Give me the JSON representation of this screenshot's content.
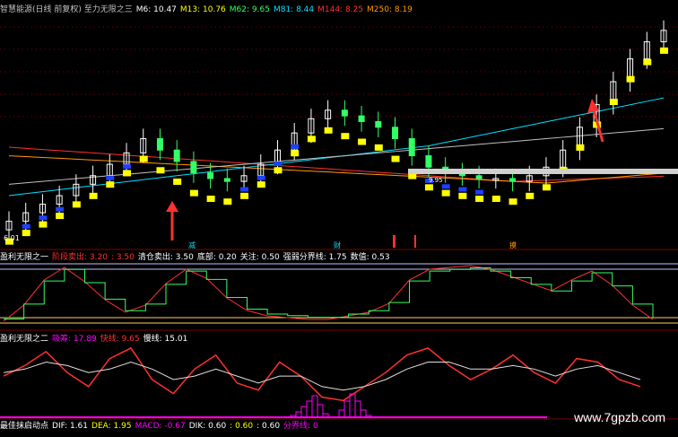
{
  "colors": {
    "bg": "#000000",
    "up": "#ff3030",
    "down": "#00e0ff",
    "white": "#ffffff",
    "yellow": "#ffff00",
    "green": "#33ff66",
    "magenta": "#ff00ff",
    "orange": "#ff9900",
    "gray": "#c0c0c0"
  },
  "panel1": {
    "header": [
      {
        "text": "智慧能源(日线 前复权) 至力无限之三",
        "color": "#c0c0c0"
      },
      {
        "text": "M6: 10.47",
        "color": "#ffffff"
      },
      {
        "text": "M13: 10.76",
        "color": "#ffff00"
      },
      {
        "text": "M62: 9.65",
        "color": "#33ff66"
      },
      {
        "text": "M81: 8.44",
        "color": "#00e0ff"
      },
      {
        "text": "M144: 8.25",
        "color": "#ff3030"
      },
      {
        "text": "M250: 8.19",
        "color": "#ff9900"
      }
    ],
    "low_label": "6.01",
    "level_label": "9.95",
    "markers": [
      "减",
      "财",
      "摸"
    ]
  },
  "panel2": {
    "header": [
      {
        "text": "盈利无限之一",
        "color": "#ffffff"
      },
      {
        "text": "阶段卖出: 3.20",
        "color": "#ff3030"
      },
      {
        "text": ": 3.50",
        "color": "#ff3030"
      },
      {
        "text": "清仓卖出: 3.50",
        "color": "#ffffff"
      },
      {
        "text": "底部: 0.20",
        "color": "#ffffff"
      },
      {
        "text": "关注: 0.50",
        "color": "#ffffff"
      },
      {
        "text": "强弱分界线: 1.75",
        "color": "#ffffff"
      },
      {
        "text": "数值: 0.53",
        "color": "#ffffff"
      }
    ]
  },
  "panel3": {
    "header": [
      {
        "text": "盈利无限之二",
        "color": "#ffffff"
      },
      {
        "text": "吸筹: 17.89",
        "color": "#ff00ff"
      },
      {
        "text": "快线: 9.65",
        "color": "#ff3030"
      },
      {
        "text": "慢线: 15.01",
        "color": "#ffffff"
      }
    ]
  },
  "panel4": {
    "header": [
      {
        "text": "最佳抹启动点",
        "color": "#ffffff"
      },
      {
        "text": "DIF: 1.61",
        "color": "#ffffff"
      },
      {
        "text": "DEA: 1.95",
        "color": "#ffff00"
      },
      {
        "text": "MACD: -0.67",
        "color": "#ff00ff"
      },
      {
        "text": "DIK: 0.60",
        "color": "#ffffff"
      },
      {
        "text": ": 0.60",
        "color": "#ffff00"
      },
      {
        "text": ": 0.60",
        "color": "#ffffff"
      },
      {
        "text": "分界线: 0",
        "color": "#ff00ff"
      }
    ]
  },
  "chart_data": [
    {
      "type": "candlestick",
      "title": "智慧能源(日线 前复权)",
      "series": [
        {
          "name": "M6",
          "last": 10.47
        },
        {
          "name": "M13",
          "last": 10.76
        },
        {
          "name": "M62",
          "last": 9.65
        },
        {
          "name": "M81",
          "last": 8.44
        },
        {
          "name": "M144",
          "last": 8.25
        },
        {
          "name": "M250",
          "last": 8.19
        }
      ],
      "ylim": [
        5.5,
        13.5
      ],
      "close": [
        6.3,
        6.6,
        6.9,
        7.2,
        7.6,
        7.9,
        8.3,
        8.7,
        9.2,
        8.8,
        8.4,
        8.0,
        7.8,
        7.7,
        7.9,
        8.3,
        8.8,
        9.4,
        9.9,
        10.2,
        10.0,
        9.8,
        9.6,
        9.2,
        8.6,
        8.2,
        8.0,
        7.9,
        7.8,
        7.8,
        7.7,
        7.9,
        8.2,
        8.8,
        9.6,
        10.4,
        11.2,
        12.0,
        12.6,
        13.0
      ]
    },
    {
      "type": "line",
      "title": "盈利无限之一",
      "series": [
        {
          "name": "阶段卖出",
          "values": [
            0.3,
            1.2,
            2.6,
            3.3,
            2.5,
            1.5,
            0.8,
            1.2,
            2.4,
            3.2,
            2.7,
            1.6,
            0.9,
            0.6,
            0.5,
            0.4,
            0.4,
            0.6,
            0.8,
            1.3,
            2.6,
            3.2,
            3.3,
            3.4,
            3.2,
            2.8,
            2.4,
            2.0,
            2.6,
            3.1,
            2.3,
            1.2,
            0.4
          ]
        },
        {
          "name": "强弱分界线",
          "values": [
            1.75
          ]
        }
      ],
      "ylim": [
        0,
        3.6
      ]
    },
    {
      "type": "line",
      "title": "盈利无限之二",
      "series": [
        {
          "name": "快线",
          "values": [
            11,
            14,
            18,
            12,
            8,
            16,
            19,
            10,
            6,
            13,
            17,
            9,
            7,
            15,
            11,
            5,
            4,
            8,
            12,
            17,
            19,
            14,
            10,
            13,
            17,
            12,
            9,
            16,
            15,
            10,
            8
          ]
        },
        {
          "name": "慢线",
          "values": [
            12,
            13,
            15,
            14,
            12,
            13,
            15,
            13,
            10,
            11,
            13,
            11,
            9,
            11,
            11,
            8,
            7,
            8,
            10,
            13,
            15,
            15,
            13,
            13,
            14,
            13,
            11,
            13,
            14,
            12,
            10
          ]
        }
      ],
      "ylim": [
        0,
        20
      ]
    },
    {
      "type": "bar",
      "title": "最佳抹启动点",
      "series": [
        {
          "name": "MACD",
          "values": [
            0,
            0,
            0,
            0,
            0.1,
            0.3,
            0.6,
            0.9,
            1.2,
            0.7,
            0.2,
            0,
            0,
            0.4,
            0.9,
            1.3,
            0.9,
            0.4,
            0.1,
            0,
            0,
            0,
            0,
            0,
            0,
            0,
            0,
            0
          ]
        }
      ],
      "ylim": [
        0,
        1.5
      ]
    }
  ],
  "watermark": "www.7gpzb.com"
}
